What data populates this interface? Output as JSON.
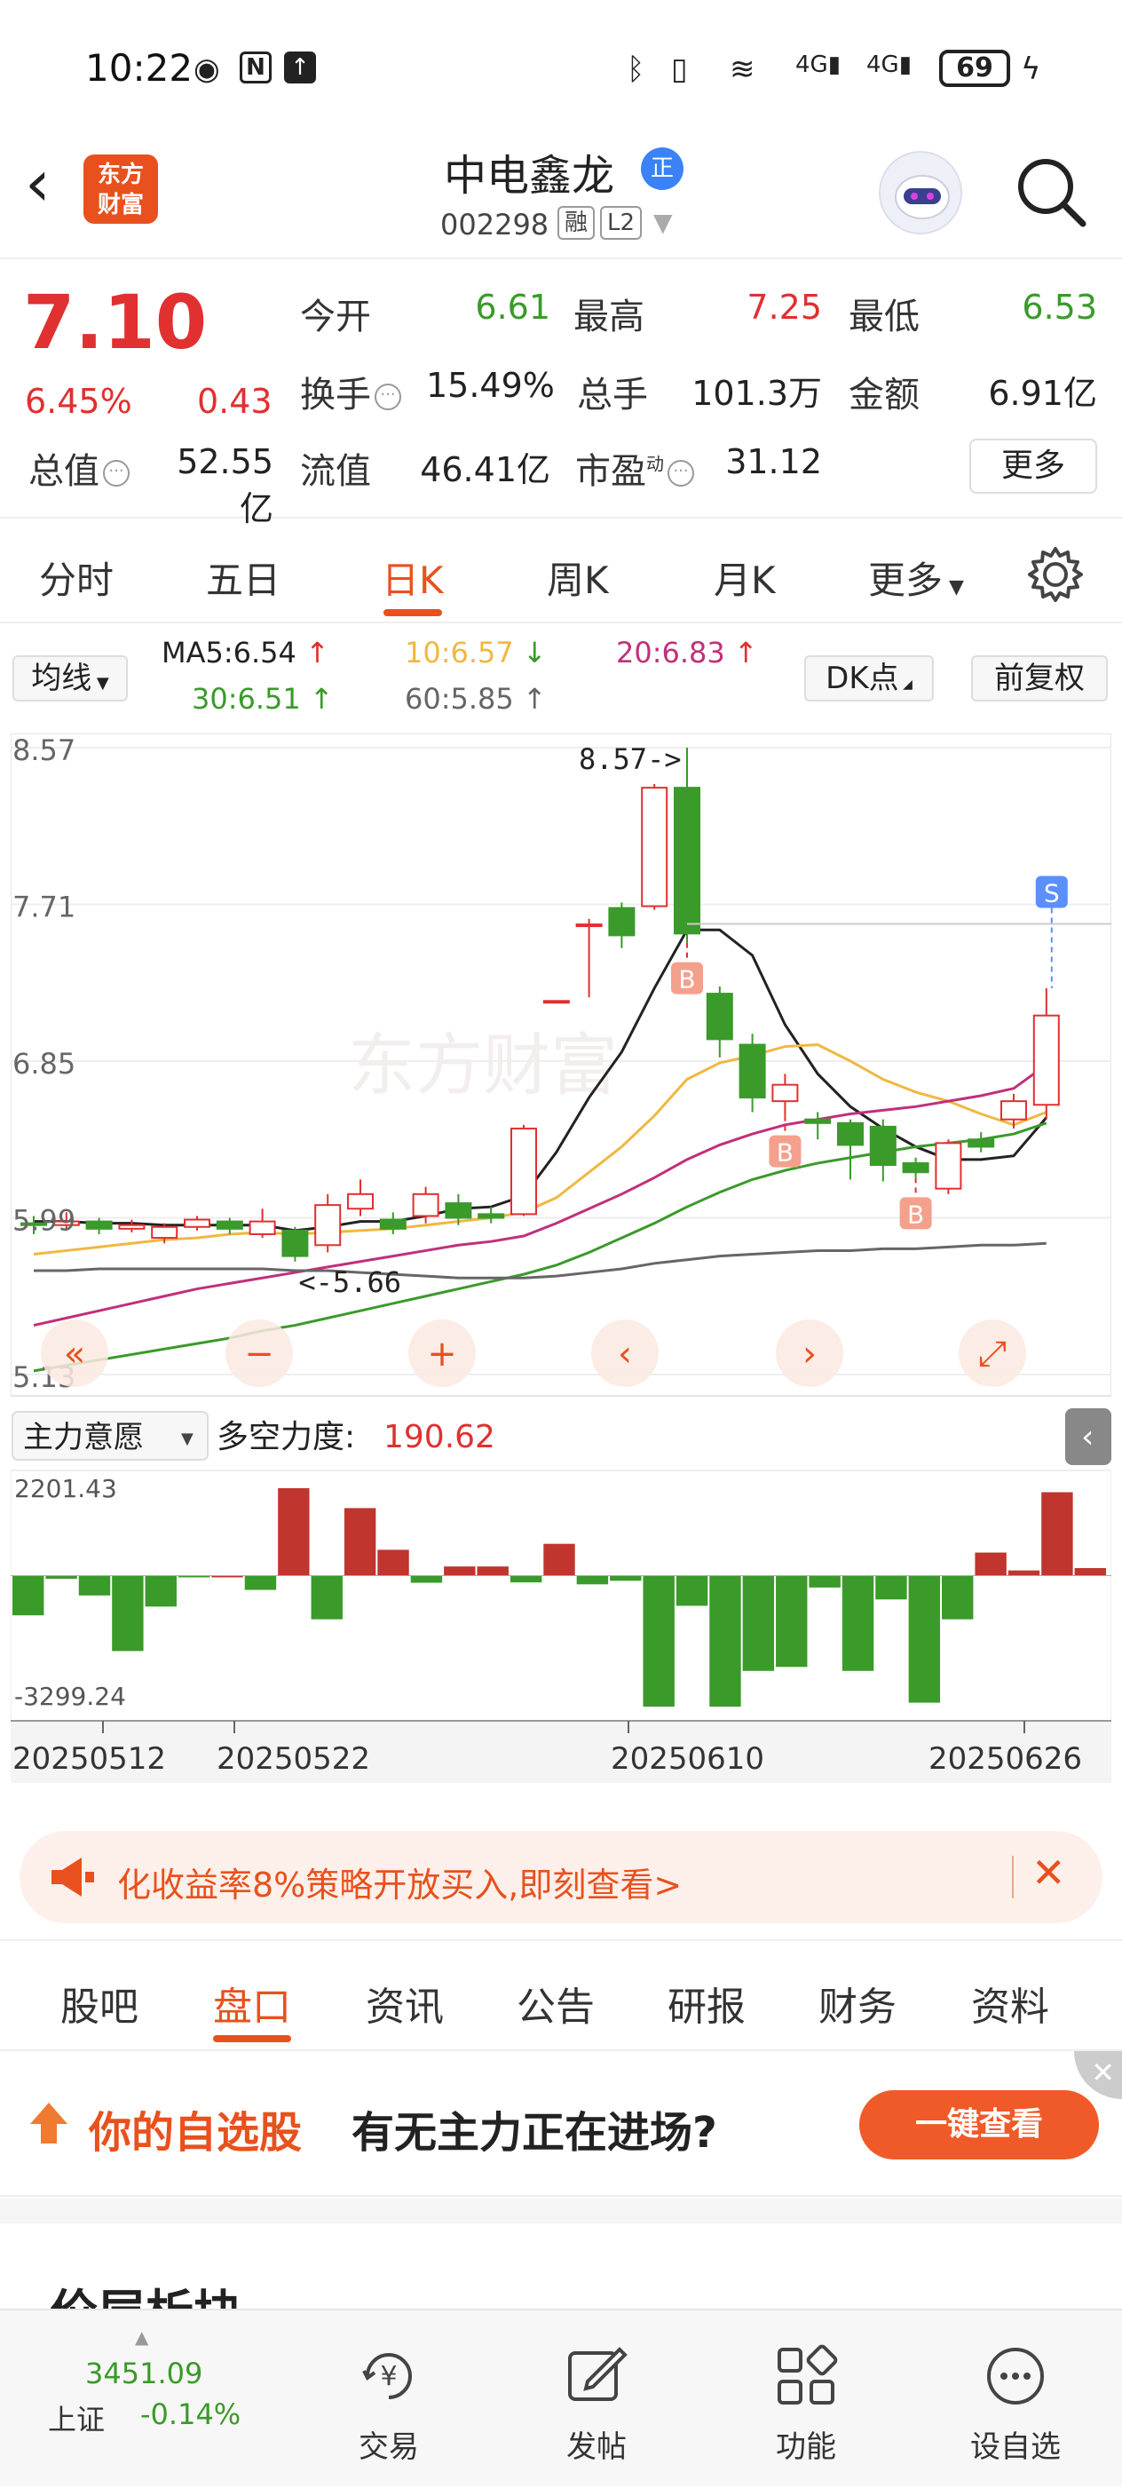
{
  "status_bar": {
    "time": "10:22",
    "battery": "69",
    "icons": [
      "eye-icon",
      "nfc-icon",
      "upload-icon",
      "bluetooth-icon",
      "vibrate-icon",
      "wifi-icon",
      "signal-4g-icon",
      "signal-4g-icon",
      "charging-icon"
    ]
  },
  "header": {
    "stock_name": "中电鑫龙",
    "badge": "正",
    "stock_code": "002298",
    "tag_rong": "融",
    "tag_level": "L2",
    "logo_line1": "东方",
    "logo_line2": "财富"
  },
  "quote": {
    "price": "7.10",
    "change_pct": "6.45%",
    "change_amt": "0.43",
    "open_label": "今开",
    "open": "6.61",
    "high_label": "最高",
    "high": "7.25",
    "low_label": "最低",
    "low": "6.53",
    "turnover_label": "换手",
    "turnover": "15.49%",
    "volume_label": "总手",
    "volume": "101.3万",
    "amount_label": "金额",
    "amount": "6.91亿",
    "mktcap_label": "总值",
    "mktcap": "52.55亿",
    "float_label": "流值",
    "float": "46.41亿",
    "pe_label": "市盈",
    "pe_sup": "动",
    "pe": "31.12",
    "more": "更多"
  },
  "period_tabs": [
    "分时",
    "五日",
    "日K",
    "周K",
    "月K",
    "更多"
  ],
  "active_period": "日K",
  "ma_row": {
    "selector": "均线",
    "ma5": "MA5:6.54",
    "ma10": "10:6.57",
    "ma20": "20:6.83",
    "ma30": "30:6.51",
    "ma60": "60:5.85",
    "dk": "DK点",
    "fq": "前复权"
  },
  "colors": {
    "up": "#e03030",
    "down": "#3a9a2a",
    "ma5": "#222222",
    "ma10": "#f0b840",
    "ma20": "#c0307a",
    "ma30": "#3a9a2a",
    "ma60": "#666666",
    "accent": "#e8511d"
  },
  "chart_data": [
    {
      "type": "candlestick",
      "title": "",
      "y_ticks": [
        "8.57",
        "7.71",
        "6.85",
        "5.99",
        "5.13"
      ],
      "ylim": [
        5.13,
        8.57
      ],
      "annotations": {
        "max_label": "8.57->",
        "min_label": "<-5.66",
        "buy_marker": "B",
        "sell_marker": "S",
        "watermark": "东方财富"
      },
      "candles": [
        {
          "o": 5.96,
          "c": 5.95,
          "h": 6.0,
          "l": 5.9
        },
        {
          "o": 5.95,
          "c": 5.97,
          "h": 6.02,
          "l": 5.92
        },
        {
          "o": 5.97,
          "c": 5.93,
          "h": 5.99,
          "l": 5.9
        },
        {
          "o": 5.93,
          "c": 5.95,
          "h": 5.98,
          "l": 5.91
        },
        {
          "o": 5.88,
          "c": 5.94,
          "h": 5.96,
          "l": 5.85
        },
        {
          "o": 5.94,
          "c": 5.98,
          "h": 6.0,
          "l": 5.92
        },
        {
          "o": 5.97,
          "c": 5.93,
          "h": 5.99,
          "l": 5.9
        },
        {
          "o": 5.9,
          "c": 5.97,
          "h": 6.04,
          "l": 5.88
        },
        {
          "o": 5.92,
          "c": 5.78,
          "h": 5.94,
          "l": 5.75
        },
        {
          "o": 5.84,
          "c": 6.06,
          "h": 6.12,
          "l": 5.8
        },
        {
          "o": 6.04,
          "c": 6.12,
          "h": 6.2,
          "l": 6.0
        },
        {
          "o": 5.98,
          "c": 5.93,
          "h": 6.02,
          "l": 5.9
        },
        {
          "o": 6.0,
          "c": 6.12,
          "h": 6.16,
          "l": 5.96
        },
        {
          "o": 6.07,
          "c": 5.99,
          "h": 6.12,
          "l": 5.95
        },
        {
          "o": 6.01,
          "c": 5.99,
          "h": 6.05,
          "l": 5.96
        },
        {
          "o": 6.01,
          "c": 6.48,
          "h": 6.5,
          "l": 6.0
        },
        {
          "o": 7.18,
          "c": 7.18,
          "h": 7.18,
          "l": 7.18
        },
        {
          "o": 7.6,
          "c": 7.6,
          "h": 7.63,
          "l": 7.2
        },
        {
          "o": 7.69,
          "c": 7.54,
          "h": 7.72,
          "l": 7.47
        },
        {
          "o": 7.7,
          "c": 8.35,
          "h": 8.37,
          "l": 7.68
        },
        {
          "o": 8.35,
          "c": 7.55,
          "h": 8.57,
          "l": 7.5
        },
        {
          "o": 7.22,
          "c": 6.97,
          "h": 7.26,
          "l": 6.87
        },
        {
          "o": 6.94,
          "c": 6.65,
          "h": 7.0,
          "l": 6.57
        },
        {
          "o": 6.63,
          "c": 6.72,
          "h": 6.78,
          "l": 6.55
        },
        {
          "o": 6.53,
          "c": 6.51,
          "h": 6.57,
          "l": 6.42
        },
        {
          "o": 6.51,
          "c": 6.39,
          "h": 6.53,
          "l": 6.2
        },
        {
          "o": 6.49,
          "c": 6.28,
          "h": 6.53,
          "l": 6.19
        },
        {
          "o": 6.29,
          "c": 6.24,
          "h": 6.32,
          "l": 6.21
        },
        {
          "o": 6.15,
          "c": 6.4,
          "h": 6.42,
          "l": 6.12
        },
        {
          "o": 6.42,
          "c": 6.38,
          "h": 6.46,
          "l": 6.35
        },
        {
          "o": 6.53,
          "c": 6.63,
          "h": 6.67,
          "l": 6.48
        },
        {
          "o": 6.61,
          "c": 7.1,
          "h": 7.25,
          "l": 6.53
        }
      ],
      "ma_series": [
        {
          "name": "MA5",
          "values": [
            5.97,
            5.97,
            5.96,
            5.96,
            5.95,
            5.95,
            5.95,
            5.95,
            5.92,
            5.94,
            5.97,
            5.97,
            6.0,
            6.04,
            6.05,
            6.11,
            6.35,
            6.65,
            6.9,
            7.25,
            7.57,
            7.57,
            7.43,
            7.05,
            6.78,
            6.6,
            6.48,
            6.38,
            6.31,
            6.31,
            6.33,
            6.54
          ]
        },
        {
          "name": "MA10",
          "values": [
            5.79,
            5.81,
            5.83,
            5.85,
            5.87,
            5.88,
            5.9,
            5.91,
            5.9,
            5.91,
            5.92,
            5.93,
            5.95,
            5.97,
            5.99,
            6.02,
            6.1,
            6.24,
            6.38,
            6.55,
            6.75,
            6.84,
            6.88,
            6.93,
            6.94,
            6.85,
            6.75,
            6.68,
            6.63,
            6.56,
            6.5,
            6.57
          ]
        },
        {
          "name": "MA20",
          "values": [
            5.4,
            5.44,
            5.48,
            5.52,
            5.56,
            5.6,
            5.63,
            5.66,
            5.69,
            5.72,
            5.75,
            5.78,
            5.81,
            5.84,
            5.86,
            5.89,
            5.96,
            6.04,
            6.12,
            6.21,
            6.31,
            6.39,
            6.45,
            6.5,
            6.53,
            6.56,
            6.58,
            6.6,
            6.63,
            6.66,
            6.7,
            6.83
          ]
        },
        {
          "name": "MA30",
          "values": [
            5.15,
            5.18,
            5.21,
            5.24,
            5.27,
            5.3,
            5.33,
            5.37,
            5.4,
            5.44,
            5.48,
            5.52,
            5.56,
            5.6,
            5.64,
            5.68,
            5.73,
            5.8,
            5.88,
            5.96,
            6.05,
            6.13,
            6.2,
            6.25,
            6.29,
            6.32,
            6.35,
            6.38,
            6.4,
            6.42,
            6.45,
            6.51
          ]
        },
        {
          "name": "MA60",
          "values": [
            5.7,
            5.7,
            5.71,
            5.71,
            5.71,
            5.71,
            5.71,
            5.71,
            5.7,
            5.7,
            5.69,
            5.68,
            5.67,
            5.66,
            5.66,
            5.66,
            5.67,
            5.69,
            5.71,
            5.74,
            5.76,
            5.78,
            5.79,
            5.8,
            5.81,
            5.81,
            5.82,
            5.82,
            5.83,
            5.84,
            5.84,
            5.85
          ]
        }
      ],
      "buy_points": [
        20,
        23,
        27
      ],
      "sell_points": [
        31
      ]
    },
    {
      "type": "bar",
      "title": "",
      "indicator": "主力意愿",
      "indicator_label": "多空力度:",
      "indicator_value": "190.62",
      "y_ticks": [
        "2201.43",
        "-3299.24"
      ],
      "ylim": [
        -3299.24,
        2201.43
      ],
      "values": [
        -1000,
        -80,
        -500,
        -1900,
        -780,
        -30,
        0,
        -360,
        2201,
        -1100,
        1700,
        650,
        -180,
        230,
        230,
        -170,
        800,
        -220,
        -130,
        -3299,
        -760,
        -3299,
        -2400,
        -2300,
        -300,
        -2400,
        -600,
        -3200,
        -1100,
        580,
        130,
        2100,
        190
      ],
      "x_labels": [
        "20250512",
        "20250522",
        "20250610",
        "20250626"
      ]
    }
  ],
  "chart_controls": [
    "double-left-icon",
    "minus-icon",
    "plus-icon",
    "chevron-left-icon",
    "chevron-right-icon",
    "expand-icon"
  ],
  "indicator_selector": "主力意愿",
  "ad_banner": {
    "text": "化收益率8%策略开放买入,即刻查看>"
  },
  "sub_tabs": [
    "股吧",
    "盘口",
    "资讯",
    "公告",
    "研报",
    "财务",
    "资料"
  ],
  "active_sub_tab": "盘口",
  "promo": {
    "part1": "你的自选股",
    "part2": "有无主力正在进场?",
    "button": "一键查看"
  },
  "section_peek": "价层析块",
  "bottom_nav": {
    "index_value": "3451.09",
    "index_name": "上证",
    "index_change": "-0.14%",
    "items": [
      {
        "label": "交易",
        "icon": "yen-cycle-icon"
      },
      {
        "label": "发帖",
        "icon": "edit-icon"
      },
      {
        "label": "功能",
        "icon": "grid-icon"
      },
      {
        "label": "设自选",
        "icon": "more-dots-icon"
      }
    ]
  }
}
